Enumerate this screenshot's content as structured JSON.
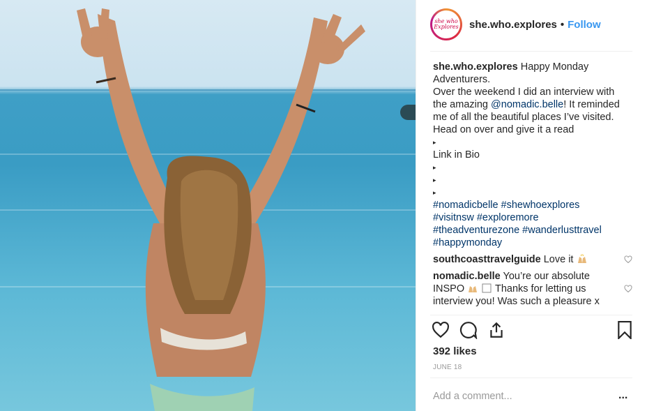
{
  "post": {
    "username": "she.who.explores",
    "follow_label": "Follow",
    "dot": "•",
    "avatar_text": "she who Explores",
    "caption_first": "Happy Monday",
    "caption_lines": [
      "Adventurers.",
      "Over the weekend I did an interview with",
      "the amazing",
      "@nomadic.belle",
      "! It reminded",
      "me of all the beautiful places I’ve visited.",
      "Head on over and give it a read",
      "▸",
      "Link in Bio",
      "▸",
      "▸",
      "▸"
    ],
    "hashtags": [
      "#nomadicbelle #shewhoexplores",
      "#visitnsw #exploremore",
      "#theadventurezone #wanderlusttravel",
      "#happymonday"
    ],
    "comments": [
      {
        "user": "southcoasttravelguide",
        "text": "Love it"
      },
      {
        "user": "nomadic.belle",
        "text_lines": [
          "You’re our absolute",
          "INSPO",
          "Thanks for letting us",
          "interview you! Was such a pleasure x"
        ]
      }
    ],
    "likes": "392 likes",
    "date": "JUNE 18",
    "add_comment_placeholder": "Add a comment...",
    "more_label": "..."
  },
  "icons": {
    "like": "heart-icon",
    "comment": "comment-bubble-icon",
    "share": "share-icon",
    "save": "bookmark-icon"
  },
  "colors": {
    "follow": "#3897f0",
    "link": "#003569",
    "muted": "#999999",
    "text": "#262626"
  }
}
